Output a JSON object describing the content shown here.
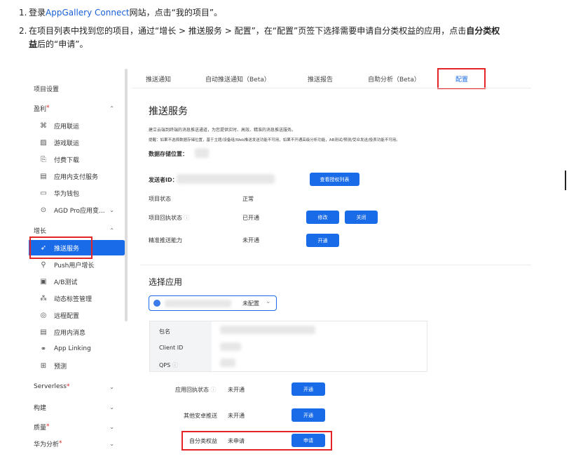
{
  "steps": {
    "s1": {
      "num": "1.",
      "prefix": "登录",
      "link": "AppGallery Connect",
      "suffix": "网站，点击“我的项目”。"
    },
    "s2": {
      "num": "2.",
      "text_a": "在项目列表中找到您的项目，通过“增长 > 推送服务 > 配置”，在“配置”页签下选择需要申请自分类权益的应用，点击",
      "bold_a": "自分类权",
      "bold_b": "益",
      "text_b": "后的“申请”。"
    }
  },
  "sidebar": {
    "project_settings": "项目设置",
    "monetize": "盈利",
    "monetize_items": [
      "应用联运",
      "游戏联运",
      "付费下载",
      "应用内支付服务",
      "华为钱包",
      "AGD Pro应用变..."
    ],
    "growth": "增长",
    "growth_items": [
      "推送服务",
      "Push用户增长",
      "A/B测试",
      "动态标签管理",
      "远程配置",
      "应用内消息",
      "App Linking",
      "预测"
    ],
    "serverless": "Serverless",
    "build": "构建",
    "quality": "质量",
    "analytics": "华为分析"
  },
  "tabs": [
    "推送通知",
    "自动推送通知（Beta）",
    "推送报告",
    "自助分析（Beta）",
    "配置"
  ],
  "push": {
    "title": "推送服务",
    "desc1": "建立云端到终端的消息推送通道，为您提供实时、高效、精准的消息推送服务。",
    "desc2": "提醒：如果不选择数据存储位置，基于主题/设备组/Web推送发送功能不可用，如果不开通高级分析功能，AB测试/预测/受众发送/投表功能不可用。",
    "storage_label": "数据存储位置：",
    "sender_label": "发送者ID：",
    "view_perm_btn": "查看授权列表",
    "status_label": "项目状态",
    "status_value": "正常",
    "receipt_label": "项目回执状态",
    "receipt_value": "已开通",
    "edit_btn": "修改",
    "close_btn": "关闭",
    "precise_label": "精准推送能力",
    "precise_value": "未开通",
    "open_btn": "开通"
  },
  "select_app": {
    "title": "选择应用",
    "dropdown_value": "未配置",
    "pkg_label": "包名",
    "client_label": "Client ID",
    "qps_label": "QPS",
    "app_receipt_label": "应用回执状态",
    "app_receipt_value": "未开通",
    "app_receipt_btn": "开通",
    "other_label": "其他安卓推送",
    "other_value": "未开通",
    "other_btn": "开通",
    "self_cls_label": "自分类权益",
    "self_cls_value": "未申请",
    "apply_btn": "申请"
  },
  "colors": {
    "accent": "#1a6be8",
    "highlight": "#e52525",
    "required": "#e52525"
  }
}
